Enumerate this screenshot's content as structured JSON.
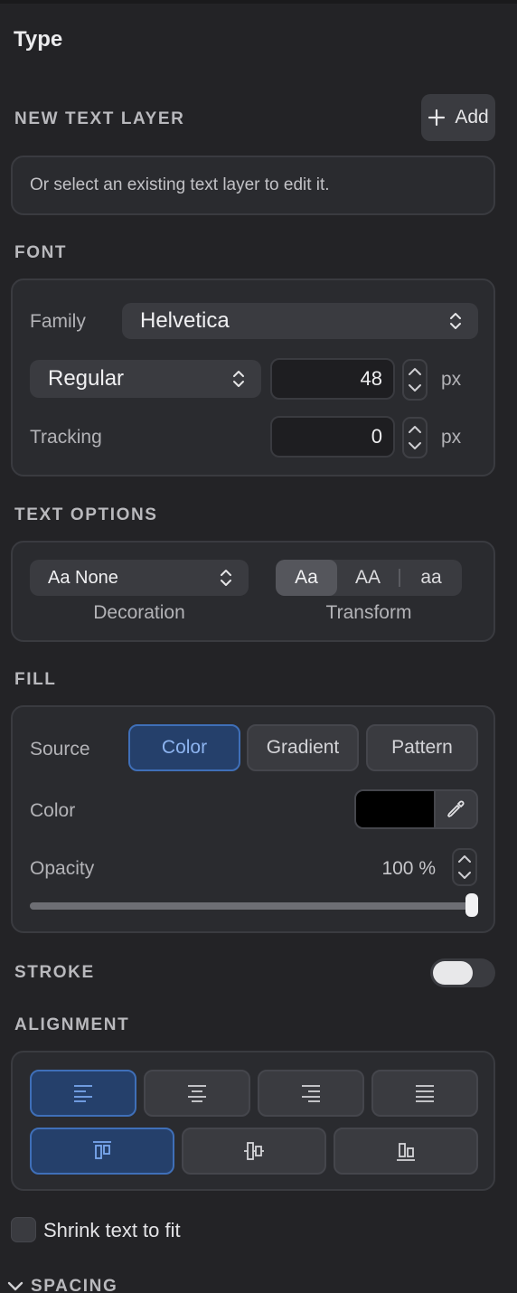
{
  "panel": {
    "title": "Type"
  },
  "new_text_layer": {
    "label": "NEW TEXT LAYER",
    "add_button": "Add",
    "hint": "Or select an existing text layer to edit it."
  },
  "font": {
    "label": "FONT",
    "family_label": "Family",
    "family_value": "Helvetica",
    "style_value": "Regular",
    "size_value": "48",
    "size_unit": "px",
    "tracking_label": "Tracking",
    "tracking_value": "0",
    "tracking_unit": "px"
  },
  "text_options": {
    "label": "TEXT OPTIONS",
    "decoration_value": "Aa None",
    "decoration_caption": "Decoration",
    "transform_options": [
      "Aa",
      "AA",
      "aa"
    ],
    "transform_selected": "Aa",
    "transform_caption": "Transform"
  },
  "fill": {
    "label": "FILL",
    "source_label": "Source",
    "source_options": [
      "Color",
      "Gradient",
      "Pattern"
    ],
    "source_selected": "Color",
    "color_label": "Color",
    "color_value": "#000000",
    "opacity_label": "Opacity",
    "opacity_value": "100 %",
    "opacity_fraction": 1.0
  },
  "stroke": {
    "label": "STROKE",
    "enabled": false
  },
  "alignment": {
    "label": "ALIGNMENT",
    "horizontal_selected": "left",
    "vertical_selected": "top"
  },
  "shrink": {
    "label": "Shrink text to fit",
    "checked": false
  },
  "spacing": {
    "label": "SPACING"
  },
  "colors": {
    "accent": "#3f6fb8",
    "background": "#232326",
    "card": "#2a2b2f"
  }
}
